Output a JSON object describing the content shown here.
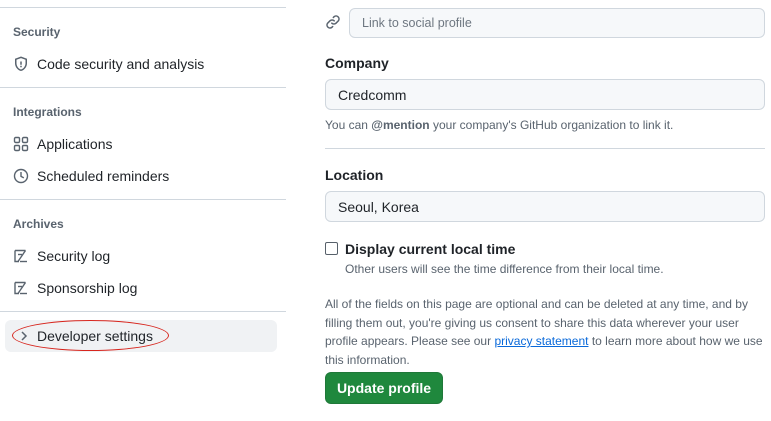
{
  "sidebar": {
    "sections": [
      {
        "title": "Security",
        "items": [
          {
            "label": "Code security and analysis",
            "icon": "shield-icon"
          }
        ]
      },
      {
        "title": "Integrations",
        "items": [
          {
            "label": "Applications",
            "icon": "apps-grid-icon"
          },
          {
            "label": "Scheduled reminders",
            "icon": "clock-icon"
          }
        ]
      },
      {
        "title": "Archives",
        "items": [
          {
            "label": "Security log",
            "icon": "log-icon"
          },
          {
            "label": "Sponsorship log",
            "icon": "log-icon"
          }
        ]
      }
    ],
    "developer_settings": {
      "label": "Developer settings",
      "icon": "chevron-right-icon"
    }
  },
  "main": {
    "social": {
      "placeholder": "Link to social profile",
      "icon": "link-icon"
    },
    "company": {
      "label": "Company",
      "value": "Credcomm",
      "note_mention": "@mention",
      "note_pre": "You can ",
      "note_post": " your company's GitHub organization to link it."
    },
    "location": {
      "label": "Location",
      "value": "Seoul, Korea"
    },
    "local_time": {
      "label": "Display current local time",
      "note": "Other users will see the time difference from their local time.",
      "checked": false
    },
    "info": {
      "pre": "All of the fields on this page are optional and can be deleted at any time, and by filling them out, you're giving us consent to share this data wherever your user profile appears. Please see our ",
      "link": "privacy statement",
      "post": " to learn more about how we use this information."
    },
    "update_button": "Update profile"
  },
  "colors": {
    "primary_button": "#1f883d",
    "link": "#0969da",
    "highlight_ring": "#d7261e"
  }
}
